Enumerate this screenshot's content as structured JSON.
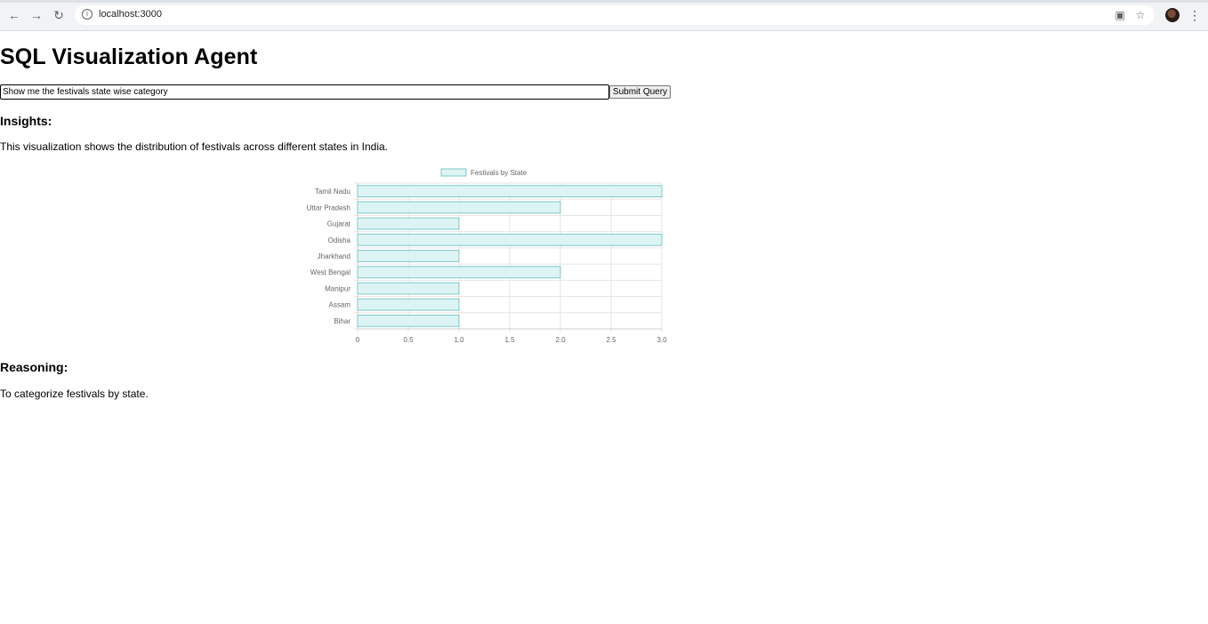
{
  "browser": {
    "url": "localhost:3000",
    "icons": {
      "back": "back-arrow-icon",
      "forward": "forward-arrow-icon",
      "reload": "reload-icon",
      "site_info": "site-info-icon",
      "install": "install-app-icon",
      "bookmark": "bookmark-star-icon",
      "menu": "more-vert-icon"
    }
  },
  "page": {
    "title": "SQL Visualization Agent",
    "query_value": "Show me the festivals state wise category",
    "submit_label": "Submit Query",
    "insights_heading": "Insights:",
    "insights_text": "This visualization shows the distribution of festivals across different states in India.",
    "reasoning_heading": "Reasoning:",
    "reasoning_text": "To categorize festivals by state."
  },
  "chart_data": {
    "type": "bar",
    "orientation": "horizontal",
    "categories": [
      "Tamil Nadu",
      "Uttar Pradesh",
      "Gujarat",
      "Odisha",
      "Jharkhand",
      "West Bengal",
      "Manipur",
      "Assam",
      "Bihar"
    ],
    "series": [
      {
        "name": "Festivals by State",
        "values": [
          3,
          2,
          1,
          3,
          1,
          2,
          1,
          1,
          1
        ]
      }
    ],
    "xlim": [
      0,
      3
    ],
    "xticks": [
      "0",
      "0.5",
      "1.0",
      "1.5",
      "2.0",
      "2.5",
      "3.0"
    ],
    "grid": true,
    "legend": "top",
    "colors": {
      "fill": "#ddf4f4",
      "stroke": "#7fc8c8",
      "grid": "#e6e6e6",
      "text": "#666666"
    }
  }
}
